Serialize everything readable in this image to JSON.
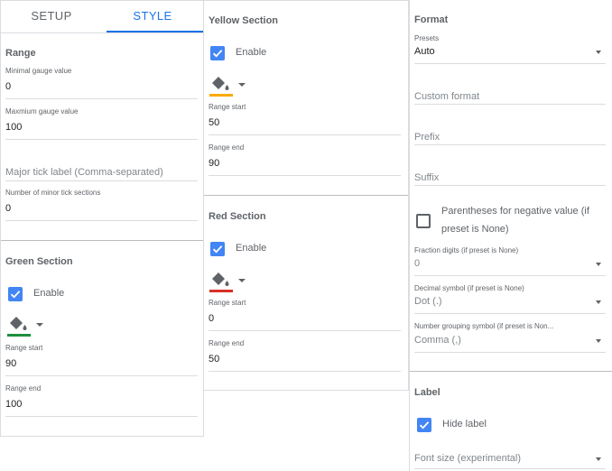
{
  "tabs": [
    {
      "label": "SETUP",
      "active": false
    },
    {
      "label": "STYLE",
      "active": true
    }
  ],
  "range": {
    "title": "Range",
    "min_label": "Minimal gauge value",
    "min_value": "0",
    "max_label": "Maxmium gauge value",
    "max_value": "100",
    "major_tick_placeholder": "Major tick label (Comma-separated)",
    "minor_label": "Number of minor tick sections",
    "minor_value": "0"
  },
  "green_section": {
    "title": "Green Section",
    "enable_label": "Enable",
    "enabled": true,
    "color": "#1e8e3e",
    "start_label": "Range start",
    "start_value": "90",
    "end_label": "Range end",
    "end_value": "100"
  },
  "yellow_section": {
    "title": "Yellow Section",
    "enable_label": "Enable",
    "enabled": true,
    "color": "#f9ab00",
    "start_label": "Range start",
    "start_value": "50",
    "end_label": "Range end",
    "end_value": "90"
  },
  "red_section": {
    "title": "Red Section",
    "enable_label": "Enable",
    "enabled": true,
    "color": "#d93025",
    "start_label": "Range start",
    "start_value": "0",
    "end_label": "Range end",
    "end_value": "50"
  },
  "format": {
    "title": "Format",
    "presets_label": "Presets",
    "presets_value": "Auto",
    "custom_format_placeholder": "Custom format",
    "prefix_placeholder": "Prefix",
    "suffix_placeholder": "Suffix",
    "parentheses_label": "Parentheses for negative value (if preset is None)",
    "parentheses_checked": false,
    "fraction_label": "Fraction digits (if preset is None)",
    "fraction_value": "0",
    "decimal_label": "Decimal symbol (if preset is None)",
    "decimal_value": "Dot (.)",
    "grouping_label": "Number grouping symbol (if preset is Non...",
    "grouping_value": "Comma (,)"
  },
  "label_section": {
    "title": "Label",
    "hide_label": "Hide label",
    "hide_checked": true,
    "font_size_placeholder": "Font size (experimental)"
  },
  "icons": {
    "checkbox": "check-icon",
    "fill_color": "paint-bucket-icon",
    "dropdown": "caret-down-icon"
  }
}
